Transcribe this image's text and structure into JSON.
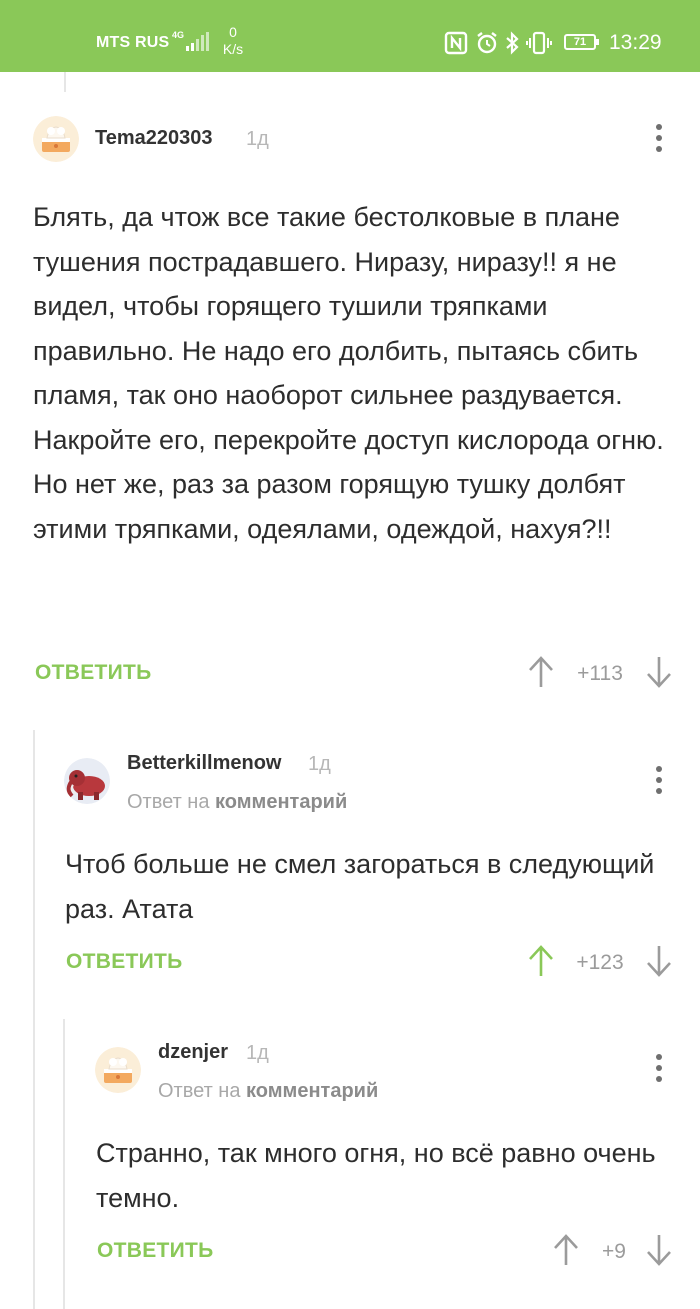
{
  "status_bar": {
    "carrier": "MTS RUS",
    "network": "4G",
    "speed_value": "0",
    "speed_unit": "K/s",
    "battery": "71",
    "time": "13:29",
    "icons": [
      "nfc-icon",
      "alarm-icon",
      "bluetooth-icon",
      "vibrate-icon",
      "battery-icon"
    ]
  },
  "colors": {
    "accent": "#8ac858",
    "text": "#2d2d2d",
    "muted": "#a8a8a8",
    "upvoted": "#8ac858"
  },
  "comments": [
    {
      "username": "Tema220303",
      "time": "1д",
      "text": "Блять, да чтож все такие бестолковые в плане тушения пострадавшего. Ниразу, ниразу!! я не видел, чтобы горящего тушили тряпками правильно. Не надо его долбить, пытаясь сбить пламя, так оно наоборот сильнее раздувается. Накройте его, перекройте доступ кислорода огню. Но нет же, раз за разом горящую тушку долбят этими тряпками, одеялами, одеждой, нахуя?!!",
      "reply_label": "ОТВЕТИТЬ",
      "rating": "+113",
      "upvoted": false
    },
    {
      "username": "Betterkillmenow",
      "time": "1д",
      "reply_prefix": "Ответ на",
      "reply_target": "комментарий",
      "text": "Чтоб больше не смел загораться в следующий раз. Атата",
      "reply_label": "ОТВЕТИТЬ",
      "rating": "+123",
      "upvoted": true
    },
    {
      "username": "dzenjer",
      "time": "1д",
      "reply_prefix": "Ответ на",
      "reply_target": "комментарий",
      "text": "Странно, так много огня, но всё равно очень темно.",
      "reply_label": "ОТВЕТИТЬ",
      "rating": "+9",
      "upvoted": false
    }
  ]
}
